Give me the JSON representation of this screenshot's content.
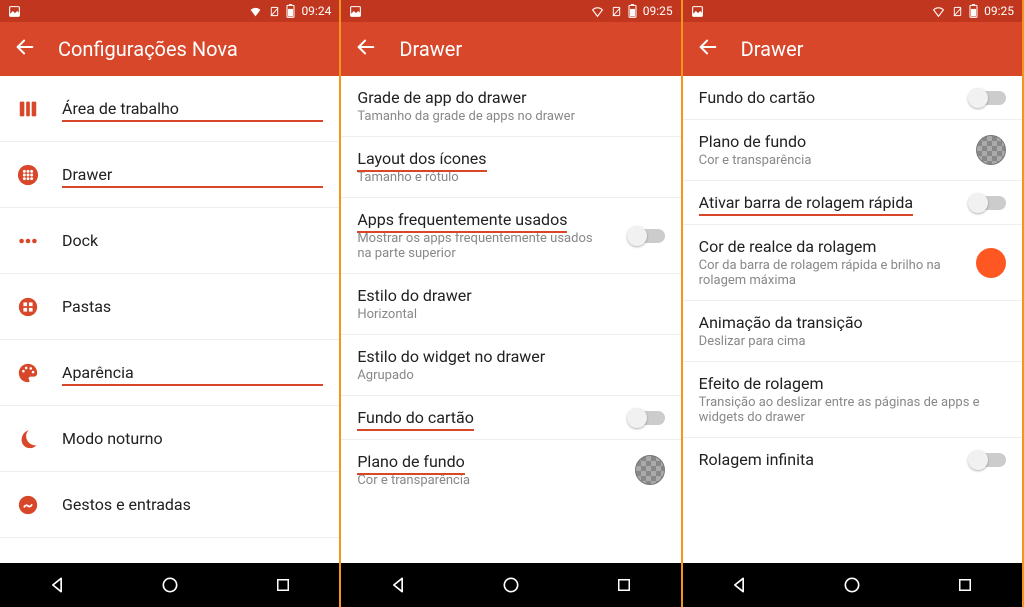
{
  "phone1": {
    "status_time": "09:24",
    "title": "Configurações Nova",
    "items": [
      {
        "label": "Área de trabalho",
        "underline": true
      },
      {
        "label": "Drawer",
        "underline": true
      },
      {
        "label": "Dock",
        "underline": false
      },
      {
        "label": "Pastas",
        "underline": false
      },
      {
        "label": "Aparência",
        "underline": true
      },
      {
        "label": "Modo noturno",
        "underline": false
      },
      {
        "label": "Gestos e entradas",
        "underline": false
      }
    ]
  },
  "phone2": {
    "status_time": "09:25",
    "title": "Drawer",
    "items": [
      {
        "label": "Grade de app do drawer",
        "sub": "Tamanho da grade de apps no drawer"
      },
      {
        "label": "Layout dos ícones",
        "sub": "Tamanho e rótulo",
        "underline": true
      },
      {
        "label": "Apps frequentemente usados",
        "sub": "Mostrar os apps frequentemente usados na parte superior",
        "underline": true,
        "toggle": "off"
      },
      {
        "label": "Estilo do drawer",
        "sub": "Horizontal"
      },
      {
        "label": "Estilo do widget no drawer",
        "sub": "Agrupado"
      },
      {
        "label": "Fundo do cartão",
        "underline": true,
        "toggle": "off"
      },
      {
        "label": "Plano de fundo",
        "sub": "Cor e transparência",
        "underline": true,
        "swatch": "checker"
      }
    ]
  },
  "phone3": {
    "status_time": "09:25",
    "title": "Drawer",
    "items": [
      {
        "label": "Fundo do cartão",
        "toggle": "off"
      },
      {
        "label": "Plano de fundo",
        "sub": "Cor e transparência",
        "swatch": "checker"
      },
      {
        "label": "Ativar barra de rolagem rápida",
        "underline": true,
        "toggle": "off"
      },
      {
        "label": "Cor de realce da rolagem",
        "sub": "Cor da barra de rolagem rápida e brilho na rolagem máxima",
        "swatch": "accent"
      },
      {
        "label": "Animação da transição",
        "sub": "Deslizar para cima"
      },
      {
        "label": "Efeito de rolagem",
        "sub": "Transição ao deslizar entre as páginas de apps e widgets do drawer"
      },
      {
        "label": "Rolagem infinita",
        "toggle": "off"
      }
    ]
  }
}
